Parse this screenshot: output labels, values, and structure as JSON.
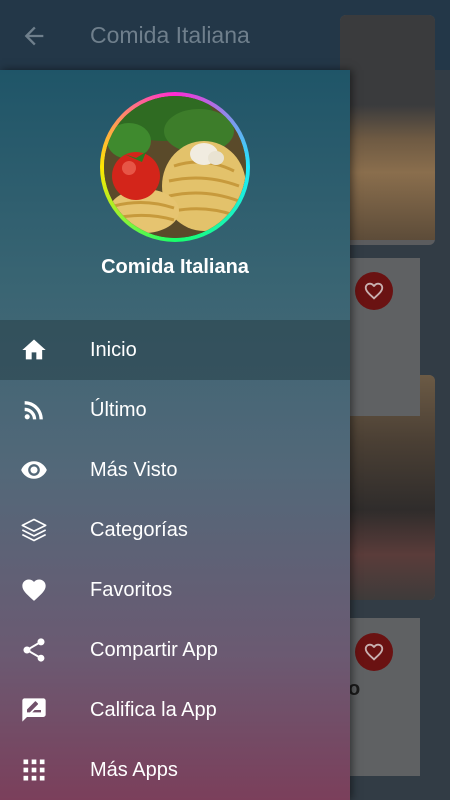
{
  "appbar": {
    "title": "Comida Italiana",
    "back_icon": "arrow-back-icon",
    "action_icon": "radio-icon"
  },
  "background": {
    "partial_text": "o"
  },
  "drawer": {
    "header_title": "Comida Italiana",
    "menu": [
      {
        "label": "Inicio",
        "icon": "home-icon",
        "active": true
      },
      {
        "label": "Último",
        "icon": "rss-icon",
        "active": false
      },
      {
        "label": "Más Visto",
        "icon": "eye-icon",
        "active": false
      },
      {
        "label": "Categorías",
        "icon": "layers-icon",
        "active": false
      },
      {
        "label": "Favoritos",
        "icon": "heart-icon",
        "active": false
      },
      {
        "label": "Compartir App",
        "icon": "share-icon",
        "active": false
      },
      {
        "label": "Califica la App",
        "icon": "rate-review-icon",
        "active": false
      },
      {
        "label": "Más Apps",
        "icon": "apps-grid-icon",
        "active": false
      }
    ]
  },
  "colors": {
    "appbar": "#233748",
    "favorite_button": "#6a1212",
    "drawer_top": "#1f5568",
    "drawer_bottom": "#7b3f5b"
  }
}
